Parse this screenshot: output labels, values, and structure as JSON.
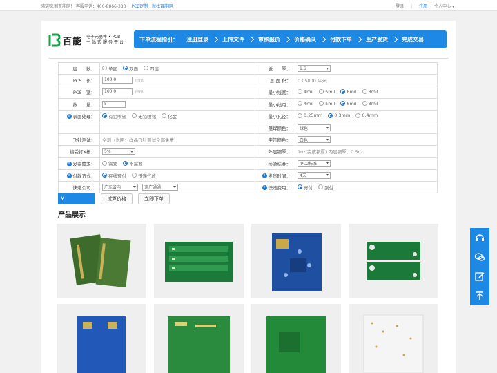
{
  "topbar": {
    "welcome": "欢迎来到百能网！",
    "hotline": "客服电话：400-8866-380",
    "pcb": "PCB定制 · 就找百能网",
    "login": "登录",
    "register": "注册",
    "usercenter": "个人中心 ▾"
  },
  "logo": {
    "brand": "百能",
    "line1": "电子元器件 • PCB",
    "line2": "一站式服务平台"
  },
  "flow": {
    "title": "下单流程指引：",
    "steps": [
      "注册登录",
      "上传文件",
      "审核报价",
      "价格确认",
      "付款下单",
      "生产发货",
      "完成交易"
    ]
  },
  "form": {
    "layers": {
      "label": "层　　数：",
      "options": [
        "单面",
        "双面",
        "四层"
      ],
      "selected": 1
    },
    "thickness": {
      "label": "板　　厚：",
      "value": "1.6"
    },
    "length": {
      "label": "PCS　长：",
      "value": "100.0",
      "unit": "mm"
    },
    "area": {
      "label": "总 面 积：",
      "value": "0.05000 平米"
    },
    "width": {
      "label": "PCS　宽：",
      "value": "100.0",
      "unit": "mm"
    },
    "min_trace": {
      "label": "最小线宽：",
      "options": [
        "4mil",
        "5mil",
        "6mil",
        "8mil"
      ],
      "selected": 2
    },
    "qty": {
      "label": "数　　量：",
      "value": "5"
    },
    "min_space": {
      "label": "最小线距：",
      "options": [
        "4mil",
        "5mil",
        "6mil",
        "8mil"
      ],
      "selected": 2
    },
    "surface": {
      "label": "表面处理：",
      "options": [
        "有铅喷锡",
        "无铅喷锡",
        "化金"
      ],
      "selected": 0
    },
    "min_hole": {
      "label": "最小孔径：",
      "options": [
        "0.25mm",
        "0.3mm",
        "0.4mm"
      ],
      "selected": 1
    },
    "mask_color": {
      "label": "阻焊颜色：",
      "value": "绿色"
    },
    "flying": {
      "label": "飞针测试：",
      "value": "全测（说明：样品飞针测试全部免费）"
    },
    "silk_color": {
      "label": "字符颜色：",
      "value": "白色"
    },
    "xout": {
      "label": "接受打X板：",
      "value": "5%"
    },
    "copper": {
      "label": "外层铜厚：",
      "value": "1oz(完成铜厚) 内层铜厚：0.5oz"
    },
    "invoice": {
      "label": "发票需求：",
      "options": [
        "需要",
        "不需要"
      ],
      "selected": 1
    },
    "standard": {
      "label": "检验标准：",
      "value": "IPC2标准"
    },
    "payment": {
      "label": "付款方式：",
      "options": [
        "在线预付",
        "快递代收"
      ],
      "selected": 0
    },
    "delivery": {
      "label": "发货时间：",
      "value": "4天"
    },
    "courier": {
      "label": "快递公司：",
      "value1": "广东省内",
      "value2": "京广通通"
    },
    "shipping_fee": {
      "label": "快递费用：",
      "options": [
        "寄付",
        "到付"
      ],
      "selected": 0
    }
  },
  "price": {
    "currency": "¥",
    "calc_button": "试算价格",
    "order_button": "立即下单"
  },
  "products": {
    "title": "产品展示"
  },
  "colors": {
    "accent": "#1e88e5",
    "pcb_green": "#1b7a3a",
    "pcb_blue": "#1f4fa0"
  },
  "side_icons": [
    "headset-icon",
    "wechat-icon",
    "edit-icon",
    "back-to-top-icon"
  ]
}
